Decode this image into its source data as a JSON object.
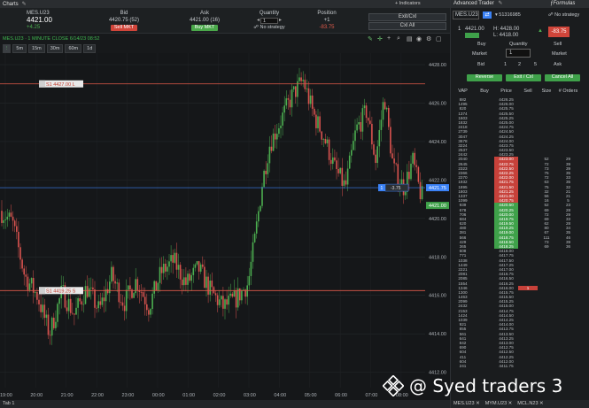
{
  "charts_title": "Charts",
  "header": {
    "symbol": "MES.U23",
    "last": "4421.00",
    "change": "+4.25",
    "bid_label": "Bid",
    "bid_value": "4420.75 (52)",
    "sell_mkt": "Sell MKT",
    "ask_label": "Ask",
    "ask_value": "4421.00 (16)",
    "buy_mkt": "Buy MKT",
    "quantity_label": "Quantity",
    "quantity_value": "1",
    "no_strategy": "No strategy",
    "position_label": "Position",
    "position_qty": "+1",
    "position_pnl": "-83.75",
    "indicators": "+ Indicators",
    "exit_cxl": "Exit/Cxl",
    "cxl_all": "Cxl All"
  },
  "chart_info": "MES.U23 · 1 MINUTE CLOSE 6/14/23 08:52",
  "timeframes": [
    "5m",
    "15m",
    "30m",
    "60m",
    "1d"
  ],
  "chart_data": {
    "type": "candlestick",
    "y_ticks": [
      "4428.00",
      "4426.00",
      "4424.00",
      "4422.00",
      "4420.00",
      "4418.00",
      "4416.00",
      "4414.00",
      "4412.00"
    ],
    "x_ticks": [
      "19:00",
      "20:00",
      "21:00",
      "22:00",
      "23:00",
      "00:00",
      "01:00",
      "02:00",
      "03:00",
      "04:00",
      "05:00",
      "06:00",
      "07:00",
      "08:00"
    ],
    "ylim": [
      4411.2,
      4428.6
    ],
    "current_price": "4421.00",
    "position_price": "4421.75",
    "stop_upper_label": "S1 4427.00 L",
    "stop_upper_price": 4427.0,
    "stop_lower_label": "S1 4419.25 S",
    "stop_lower_price": 4416.25,
    "position_tag": "-3.75",
    "position_line_price": 4421.6,
    "colors": {
      "up": "#4caf50",
      "down": "#d9534f",
      "stop": "#e05a4a",
      "position": "#3b82f6"
    }
  },
  "bottom_tab": "Tab 1",
  "trader": {
    "title": "Advanced Trader",
    "formulas": "Formulas",
    "symbol": "MES.U23",
    "account": "51316985",
    "no_strategy": "No strategy",
    "qty": "1",
    "avg_price": "4421.00",
    "high_label": "H: 4428.00",
    "low_label": "L: 4418.00",
    "pnl": "-83.75",
    "buy_label": "Buy",
    "sell_label": "Sell",
    "quantity_label": "Quantity",
    "market_left": "Market",
    "market_right": "Market",
    "qty_input": "1",
    "bid_label": "Bid",
    "ask_label": "Ask",
    "q1": "1",
    "q2": "2",
    "q3": "5",
    "reverse": "Reverse",
    "exit_cxl": "Exit / Cxl",
    "cancel_all": "Cancel All",
    "col_vap": "VAP",
    "col_buy": "Buy",
    "col_price": "Price",
    "col_sell": "Sell",
    "col_size": "Size",
    "col_orders": "# Orders",
    "tabs": [
      "MES.U23",
      "MYM.U23",
      "MCL.N23"
    ]
  },
  "ladder": [
    {
      "vap": "882",
      "price": "4426.25"
    },
    {
      "vap": "1495",
      "price": "4426.00"
    },
    {
      "vap": "820",
      "price": "4425.75"
    },
    {
      "vap": "1374",
      "price": "4425.50"
    },
    {
      "vap": "1603",
      "price": "4425.25"
    },
    {
      "vap": "1832",
      "price": "4425.00"
    },
    {
      "vap": "2418",
      "price": "4424.75"
    },
    {
      "vap": "2739",
      "price": "4424.50"
    },
    {
      "vap": "3047",
      "price": "4424.25"
    },
    {
      "vap": "3678",
      "price": "4424.00"
    },
    {
      "vap": "3224",
      "price": "4423.75"
    },
    {
      "vap": "2537",
      "price": "4423.50"
    },
    {
      "vap": "2442",
      "price": "4423.25"
    },
    {
      "vap": "2040",
      "price": "4423.00",
      "type": "ask",
      "size": "52",
      "orders": "29"
    },
    {
      "vap": "2645",
      "price": "4422.75",
      "type": "ask",
      "size": "72",
      "orders": "39"
    },
    {
      "vap": "2323",
      "price": "4422.50",
      "type": "ask",
      "size": "73",
      "orders": "39"
    },
    {
      "vap": "2366",
      "price": "4422.25",
      "type": "ask",
      "size": "75",
      "orders": "35"
    },
    {
      "vap": "2270",
      "price": "4422.00",
      "type": "ask",
      "size": "72",
      "orders": "33"
    },
    {
      "vap": "1932",
      "price": "4421.75",
      "type": "ask",
      "size": "63",
      "orders": "35"
    },
    {
      "vap": "1895",
      "price": "4421.50",
      "type": "ask",
      "size": "75",
      "orders": "32"
    },
    {
      "vap": "1803",
      "price": "4421.25",
      "type": "ask",
      "size": "32",
      "orders": "21"
    },
    {
      "vap": "1337",
      "price": "4421.00",
      "type": "ask",
      "size": "56",
      "orders": "21"
    },
    {
      "vap": "1099",
      "price": "4420.75",
      "type": "ask",
      "size": "16",
      "orders": "5"
    },
    {
      "vap": "939",
      "price": "4420.50",
      "type": "bid",
      "size": "52",
      "orders": "23"
    },
    {
      "vap": "678",
      "price": "4420.25",
      "type": "bid",
      "size": "69",
      "orders": "28"
    },
    {
      "vap": "706",
      "price": "4420.00",
      "type": "bid",
      "size": "72",
      "orders": "29"
    },
    {
      "vap": "684",
      "price": "4419.75",
      "type": "bid",
      "size": "69",
      "orders": "33"
    },
    {
      "vap": "620",
      "price": "4419.50",
      "type": "bid",
      "size": "62",
      "orders": "28"
    },
    {
      "vap": "480",
      "price": "4419.25",
      "type": "bid",
      "size": "80",
      "orders": "34"
    },
    {
      "vap": "381",
      "price": "4419.00",
      "type": "bid",
      "size": "67",
      "orders": "35"
    },
    {
      "vap": "566",
      "price": "4418.75",
      "type": "bid",
      "size": "111",
      "orders": "46"
    },
    {
      "vap": "429",
      "price": "4418.50",
      "type": "bid",
      "size": "73",
      "orders": "39"
    },
    {
      "vap": "365",
      "price": "4418.25",
      "type": "bid",
      "size": "69",
      "orders": "36"
    },
    {
      "vap": "608",
      "price": "4418.00"
    },
    {
      "vap": "771",
      "price": "4417.75"
    },
    {
      "vap": "1038",
      "price": "4417.50"
    },
    {
      "vap": "1449",
      "price": "4417.25"
    },
    {
      "vap": "2221",
      "price": "4417.00"
    },
    {
      "vap": "2081",
      "price": "4416.75"
    },
    {
      "vap": "2085",
      "price": "4416.50"
    },
    {
      "vap": "1554",
      "price": "4416.25"
    },
    {
      "vap": "1346",
      "price": "4416.00",
      "sell": "1"
    },
    {
      "vap": "1300",
      "price": "4415.75"
    },
    {
      "vap": "1463",
      "price": "4415.50"
    },
    {
      "vap": "2099",
      "price": "4415.25"
    },
    {
      "vap": "2432",
      "price": "4415.00"
    },
    {
      "vap": "2153",
      "price": "4414.75"
    },
    {
      "vap": "1424",
      "price": "4414.50"
    },
    {
      "vap": "1039",
      "price": "4414.25"
    },
    {
      "vap": "921",
      "price": "4414.00"
    },
    {
      "vap": "855",
      "price": "4413.75"
    },
    {
      "vap": "561",
      "price": "4413.50"
    },
    {
      "vap": "641",
      "price": "4413.25"
    },
    {
      "vap": "842",
      "price": "4413.00"
    },
    {
      "vap": "690",
      "price": "4412.75"
    },
    {
      "vap": "604",
      "price": "4412.50"
    },
    {
      "vap": "411",
      "price": "4412.25"
    },
    {
      "vap": "604",
      "price": "4412.00"
    },
    {
      "vap": "241",
      "price": "4411.75"
    }
  ],
  "watermark": "@ Syed traders 3"
}
